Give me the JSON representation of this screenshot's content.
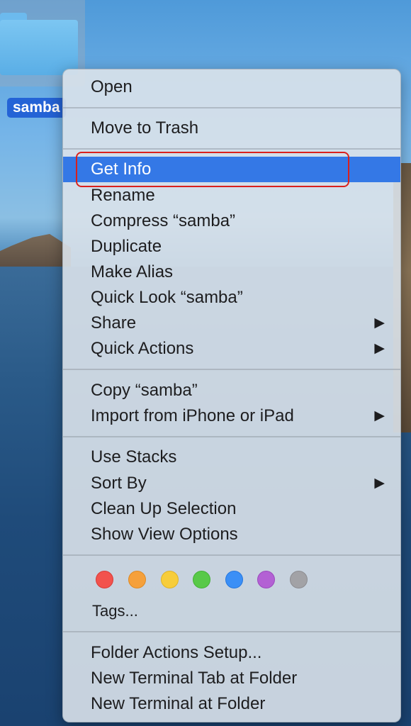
{
  "desktop": {
    "folder_name": "samba"
  },
  "menu": {
    "items": [
      {
        "label": "Open",
        "submenu": false
      },
      {
        "label": "Move to Trash",
        "submenu": false
      },
      {
        "label": "Get Info",
        "submenu": false,
        "selected": true
      },
      {
        "label": "Rename",
        "submenu": false
      },
      {
        "label": "Compress “samba”",
        "submenu": false
      },
      {
        "label": "Duplicate",
        "submenu": false
      },
      {
        "label": "Make Alias",
        "submenu": false
      },
      {
        "label": "Quick Look “samba”",
        "submenu": false
      },
      {
        "label": "Share",
        "submenu": true
      },
      {
        "label": "Quick Actions",
        "submenu": true
      },
      {
        "label": "Copy “samba”",
        "submenu": false
      },
      {
        "label": "Import from iPhone or iPad",
        "submenu": true
      },
      {
        "label": "Use Stacks",
        "submenu": false
      },
      {
        "label": "Sort By",
        "submenu": true
      },
      {
        "label": "Clean Up Selection",
        "submenu": false
      },
      {
        "label": "Show View Options",
        "submenu": false
      },
      {
        "label": "Tags...",
        "submenu": false
      },
      {
        "label": "Folder Actions Setup...",
        "submenu": false
      },
      {
        "label": "New Terminal Tab at Folder",
        "submenu": false
      },
      {
        "label": "New Terminal at Folder",
        "submenu": false
      }
    ],
    "submenu_arrow": "▶",
    "tag_colors": [
      {
        "name": "red",
        "color": "#f2524d"
      },
      {
        "name": "orange",
        "color": "#f5a03b"
      },
      {
        "name": "yellow",
        "color": "#f7cd3b"
      },
      {
        "name": "green",
        "color": "#58c948"
      },
      {
        "name": "blue",
        "color": "#3b8ff6"
      },
      {
        "name": "purple",
        "color": "#b361d4"
      },
      {
        "name": "gray",
        "color": "#a2a2a6"
      }
    ]
  },
  "accent_color": "#3478e6",
  "annotation_color": "#d9201d"
}
